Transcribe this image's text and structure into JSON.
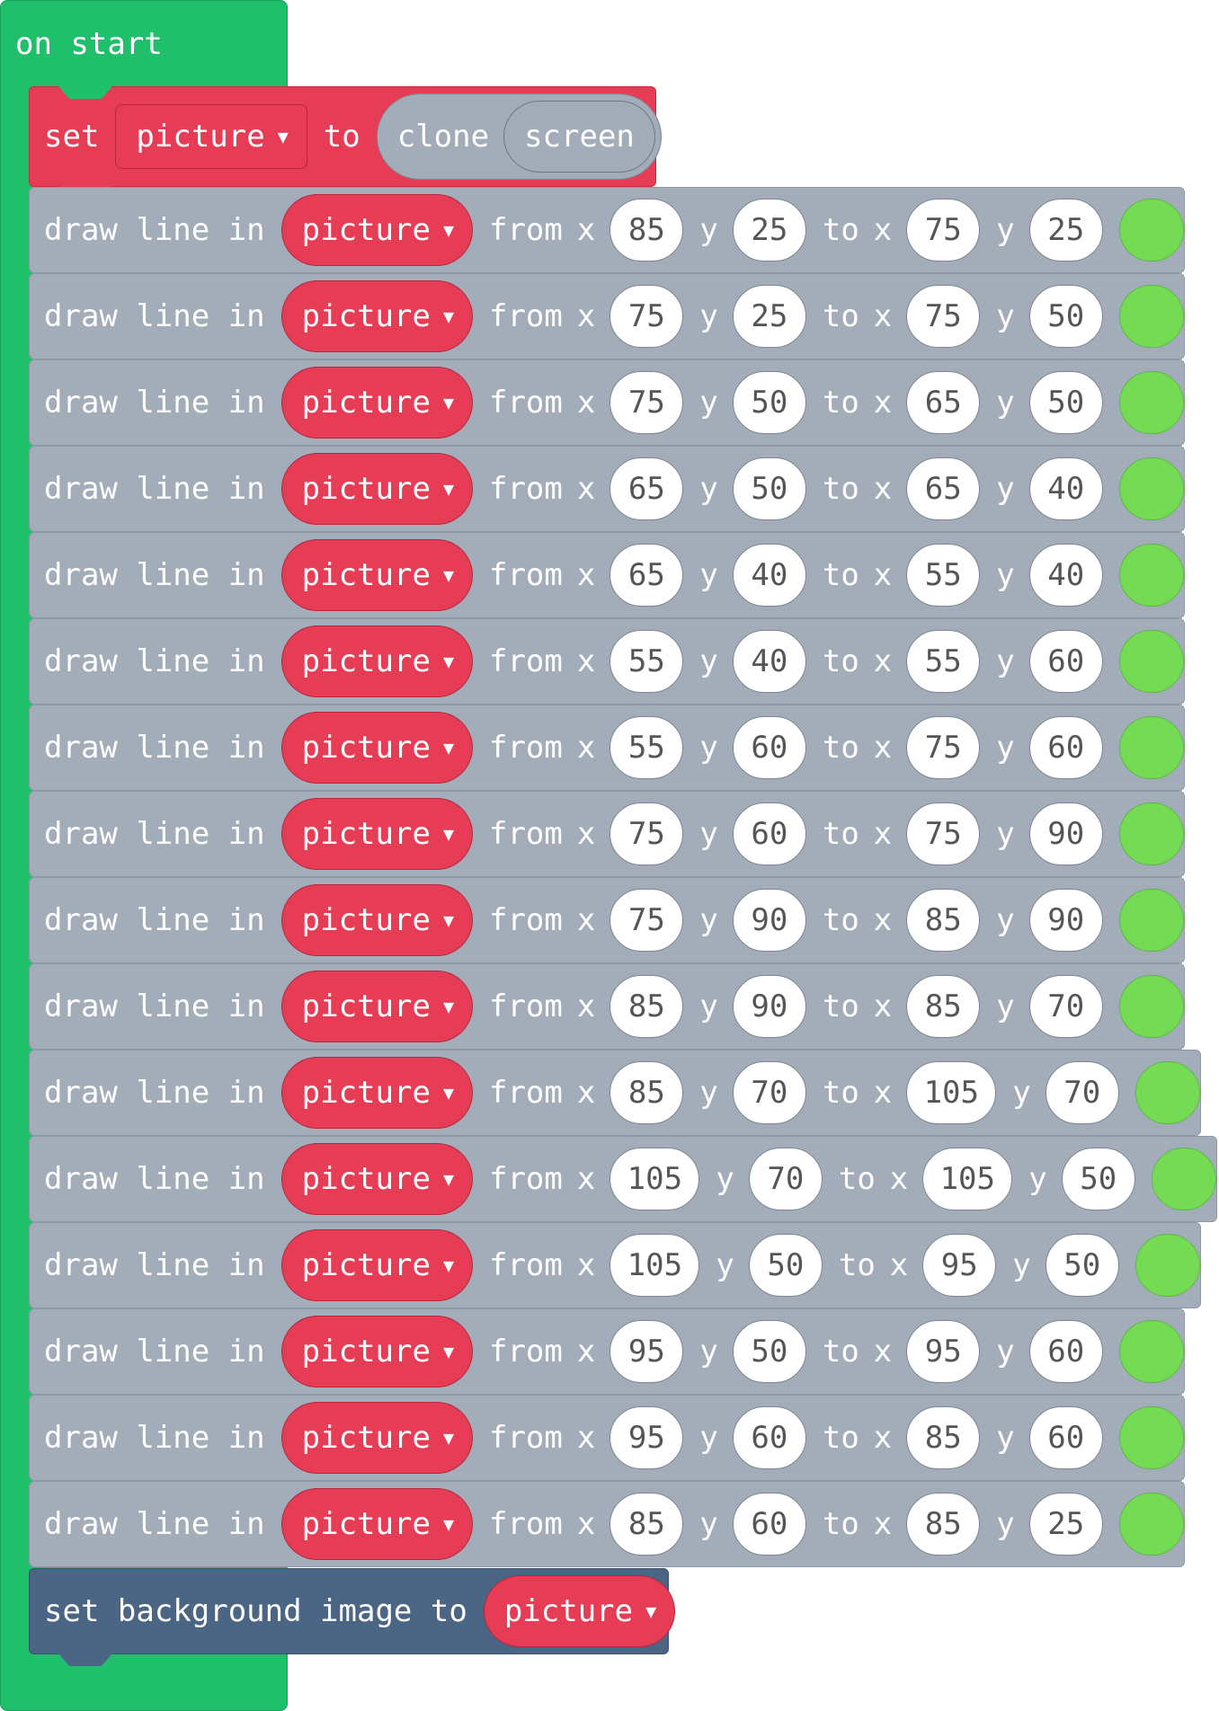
{
  "hat": {
    "label": "on start"
  },
  "set_block": {
    "set": "set",
    "var": "picture",
    "to": "to",
    "clone": "clone",
    "screen": "screen"
  },
  "draw_labels": {
    "draw": "draw line in",
    "var": "picture",
    "from": "from",
    "x": "x",
    "y": "y",
    "to": "to"
  },
  "draw_lines": [
    {
      "x1": "85",
      "y1": "25",
      "x2": "75",
      "y2": "25"
    },
    {
      "x1": "75",
      "y1": "25",
      "x2": "75",
      "y2": "50"
    },
    {
      "x1": "75",
      "y1": "50",
      "x2": "65",
      "y2": "50"
    },
    {
      "x1": "65",
      "y1": "50",
      "x2": "65",
      "y2": "40"
    },
    {
      "x1": "65",
      "y1": "40",
      "x2": "55",
      "y2": "40"
    },
    {
      "x1": "55",
      "y1": "40",
      "x2": "55",
      "y2": "60"
    },
    {
      "x1": "55",
      "y1": "60",
      "x2": "75",
      "y2": "60"
    },
    {
      "x1": "75",
      "y1": "60",
      "x2": "75",
      "y2": "90"
    },
    {
      "x1": "75",
      "y1": "90",
      "x2": "85",
      "y2": "90"
    },
    {
      "x1": "85",
      "y1": "90",
      "x2": "85",
      "y2": "70"
    },
    {
      "x1": "85",
      "y1": "70",
      "x2": "105",
      "y2": "70"
    },
    {
      "x1": "105",
      "y1": "70",
      "x2": "105",
      "y2": "50"
    },
    {
      "x1": "105",
      "y1": "50",
      "x2": "95",
      "y2": "50"
    },
    {
      "x1": "95",
      "y1": "50",
      "x2": "95",
      "y2": "60"
    },
    {
      "x1": "95",
      "y1": "60",
      "x2": "85",
      "y2": "60"
    },
    {
      "x1": "85",
      "y1": "60",
      "x2": "85",
      "y2": "25"
    }
  ],
  "line_color": "#75db55",
  "bg_block": {
    "label": "set background image to",
    "var": "picture"
  }
}
